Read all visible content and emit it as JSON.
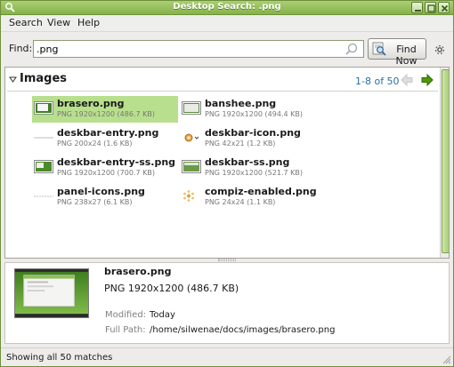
{
  "window": {
    "title": "Desktop Search: .png"
  },
  "menu": [
    {
      "label": "Search"
    },
    {
      "label": "View"
    },
    {
      "label": "Help"
    }
  ],
  "find": {
    "label": "Find:",
    "value": ".png",
    "button_label": "Find Now"
  },
  "results": {
    "group_title": "Images",
    "page_info": "1-8 of 50",
    "items": [
      {
        "name": "brasero.png",
        "meta": "PNG 1920x1200 (486.7 KB)",
        "thumb": "screenshot-thumbnail",
        "selected": true
      },
      {
        "name": "banshee.png",
        "meta": "PNG 1920x1200 (494.4 KB)",
        "thumb": "screenshot-thumbnail"
      },
      {
        "name": "deskbar-entry.png",
        "meta": "PNG 200x24 (1.6 KB)",
        "thumb": "strip-thumbnail"
      },
      {
        "name": "deskbar-icon.png",
        "meta": "PNG 42x21 (1.2 KB)",
        "thumb": "icon-thumbnail"
      },
      {
        "name": "deskbar-entry-ss.png",
        "meta": "PNG 1920x1200 (700.7 KB)",
        "thumb": "screenshot-thumbnail"
      },
      {
        "name": "deskbar-ss.png",
        "meta": "PNG 1920x1200 (521.7 KB)",
        "thumb": "screenshot-thumbnail"
      },
      {
        "name": "panel-icons.png",
        "meta": "PNG 238x27 (6.1 KB)",
        "thumb": "strip-thumbnail"
      },
      {
        "name": "compiz-enabled.png",
        "meta": "PNG 24x24 (1.1 KB)",
        "thumb": "star-thumbnail"
      }
    ]
  },
  "preview": {
    "name": "brasero.png",
    "type": "PNG 1920x1200 (486.7 KB)",
    "fields": [
      {
        "label": "Modified:",
        "value": "Today"
      },
      {
        "label": "Full Path:",
        "value": "/home/silwenae/docs/images/brasero.png"
      }
    ]
  },
  "status": {
    "text": "Showing all 50 matches"
  },
  "colors": {
    "accent": "#a9cf73",
    "selection": "#b8df8d",
    "link": "#2d6e9e"
  }
}
